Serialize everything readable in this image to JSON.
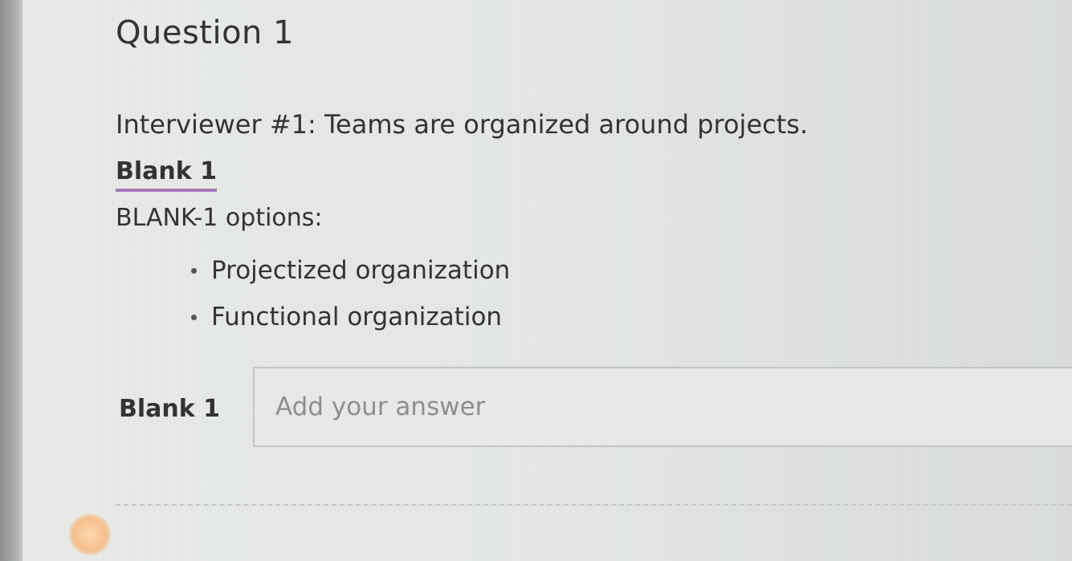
{
  "question": {
    "title": "Question 1",
    "prompt": "Interviewer #1: Teams are organized around projects."
  },
  "blank_tab": {
    "label": "Blank 1"
  },
  "options": {
    "heading": "BLANK-1 options:",
    "items": [
      "Projectized organization",
      "Functional organization"
    ]
  },
  "answer": {
    "label": "Blank 1",
    "placeholder": "Add your answer",
    "value": ""
  },
  "colors": {
    "tab_underline": "#a678b7"
  }
}
